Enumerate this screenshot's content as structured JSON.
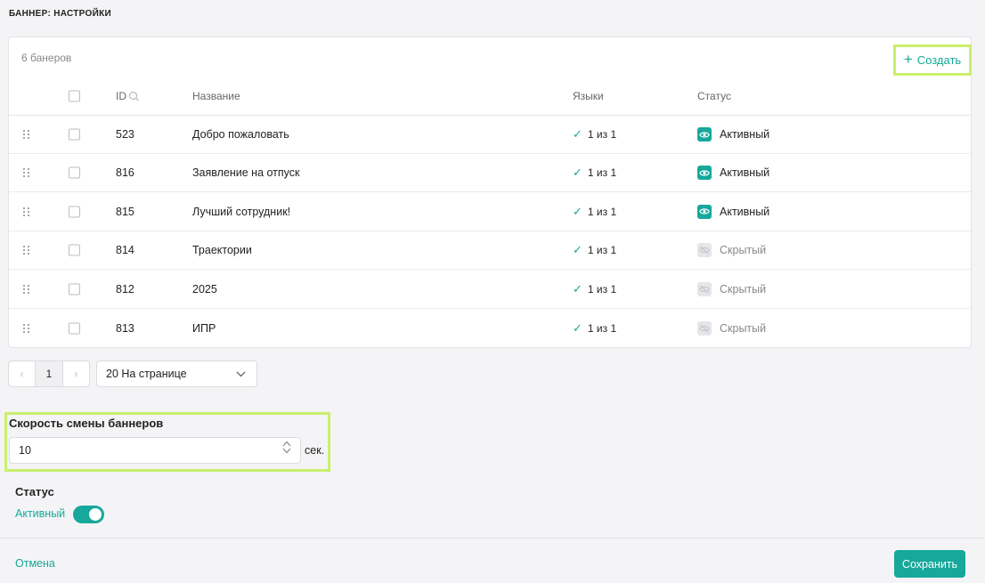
{
  "page": {
    "title": "БАННЕР: НАСТРОЙКИ"
  },
  "table": {
    "count_label": "6 банеров",
    "create_label": "Создать",
    "headers": {
      "id": "ID",
      "name": "Название",
      "languages": "Языки",
      "status": "Статус"
    },
    "rows": [
      {
        "id": "523",
        "name": "Добро пожаловать",
        "languages": "1 из 1",
        "status": "Активный",
        "status_type": "active"
      },
      {
        "id": "816",
        "name": "Заявление на отпуск",
        "languages": "1 из 1",
        "status": "Активный",
        "status_type": "active"
      },
      {
        "id": "815",
        "name": "Лучший сотрудник!",
        "languages": "1 из 1",
        "status": "Активный",
        "status_type": "active"
      },
      {
        "id": "814",
        "name": "Траектории",
        "languages": "1 из 1",
        "status": "Скрытый",
        "status_type": "hidden"
      },
      {
        "id": "812",
        "name": "2025",
        "languages": "1 из 1",
        "status": "Скрытый",
        "status_type": "hidden"
      },
      {
        "id": "813",
        "name": "ИПР",
        "languages": "1 из 1",
        "status": "Скрытый",
        "status_type": "hidden"
      }
    ]
  },
  "pagination": {
    "current_page": "1",
    "per_page": "20 На странице"
  },
  "speed": {
    "label": "Скорость смены баннеров",
    "value": "10",
    "unit": "сек."
  },
  "status_section": {
    "title": "Статус",
    "toggle_label": "Активный",
    "toggle_on": true
  },
  "footer": {
    "cancel_label": "Отмена",
    "save_label": "Сохранить"
  },
  "colors": {
    "accent": "#16a89a",
    "highlight": "#c9f06b"
  }
}
